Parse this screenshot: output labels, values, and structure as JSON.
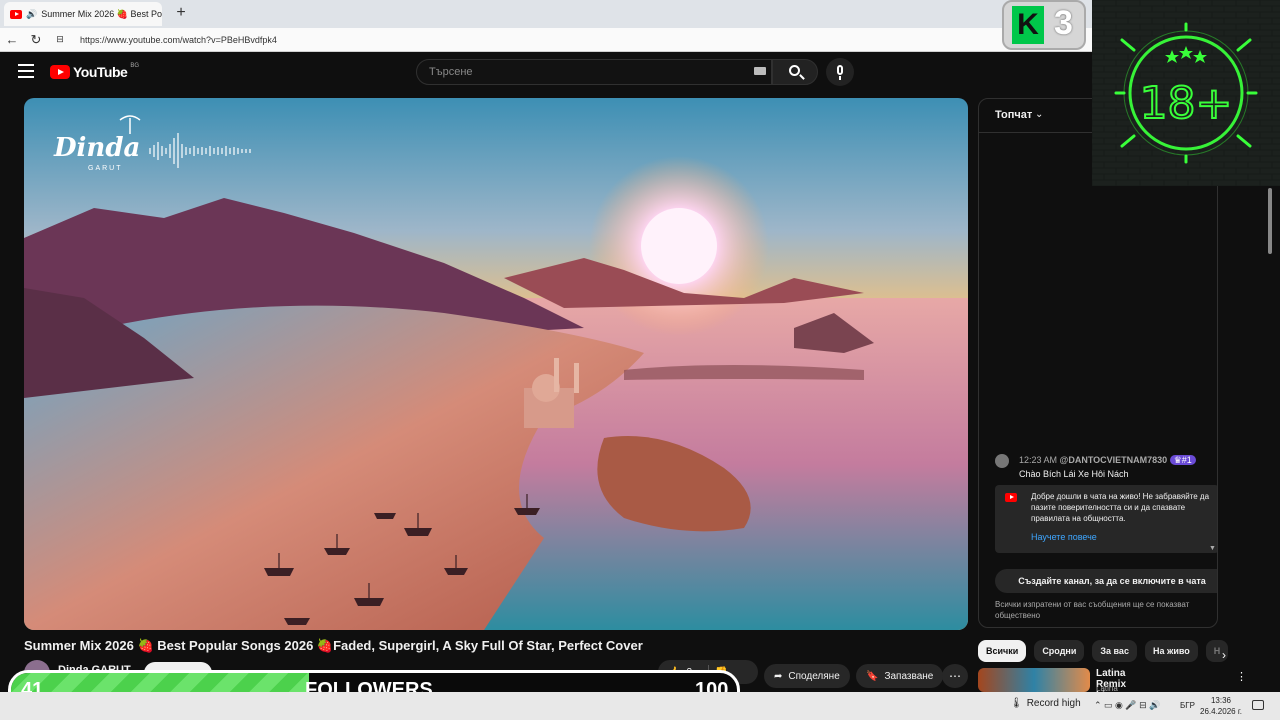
{
  "browser": {
    "tab_title": "Summer Mix 2026 🍓 Best Po",
    "url": "https://www.youtube.com/watch?v=PBeHBvdfpk4"
  },
  "youtube": {
    "logo_text": "YouTube",
    "country_code": "BG",
    "search_placeholder": "Търсене"
  },
  "video": {
    "overlay_brand": "Dinda",
    "overlay_brand_sub": "GARUT",
    "title": "Summer Mix 2026 🍓 Best Popular Songs 2026 🍓Faded, Supergirl, A Sky Full Of Star, Perfect Cover",
    "channel_name": "Dinda GARUT",
    "like_count": "2",
    "share_label": "Споделяне",
    "save_label": "Запазване"
  },
  "chat": {
    "header": "Топчат",
    "message": {
      "time": "12:23 AM",
      "author": "@DANTOCVIETNAM7830",
      "badge": "#1",
      "text": "Chào Bích Lái Xe Hôi Nách"
    },
    "welcome_text": "Добре дошли в чата на живо! Не забравяйте да пазите поверителността си и да спазвате правилата на общността.",
    "learn_more": "Научете повече",
    "create_channel": "Създайте канал, за да се включите в чата",
    "public_note": "Всички изпратени от вас съобщения ще се показват обществено"
  },
  "chips": [
    "Всички",
    "Сродни",
    "За вас",
    "На живо",
    "Н"
  ],
  "recommendation": {
    "title": "Latina Remix Live Stream",
    "channel": "Latina Remix"
  },
  "overlays": {
    "k3_letter": "K",
    "k3_number": "3",
    "age_label": "18+",
    "followers_current": "41",
    "followers_label": "FOLLOWERS",
    "followers_goal": "100",
    "followers_progress_fraction": 0.41
  },
  "taskbar": {
    "record_label": "Record high",
    "lang": "БГР",
    "time": "13:36",
    "date": "26.4.2026 г."
  },
  "colors": {
    "youtube_red": "#ff0000",
    "accent_link": "#3ea6ff",
    "followers_bar": "#4cd14c",
    "neon_green": "#39ff3a"
  }
}
